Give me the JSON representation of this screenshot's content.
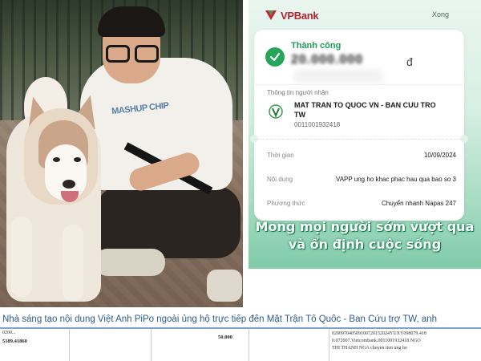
{
  "bank_app": {
    "brand": "VPBank",
    "close_label": "Xong",
    "status": "Thành công",
    "amount": "20.000.000",
    "currency": "đ",
    "recipient_section_label": "Thông tin người nhận",
    "recipient_name": "MAT TRAN TO QUOC VN - BAN CUU TRO TW",
    "recipient_account": "0011001932418",
    "time_label": "Thời gian",
    "time_value": "10/09/2024",
    "content_label": "Nội dung",
    "content_value": "VAPP ung ho khac phac hau qua bao so 3",
    "method_label": "Phương thức",
    "method_value": "Chuyển nhanh Napas 247",
    "accent_green": "#27a65a",
    "brand_red": "#b52431"
  },
  "overlay_caption": "Mong mọi người sớm vượt qua và ổn định cuộc sống",
  "headline": "Nhà sáng tạo nội dung Việt Anh PiPo ngoài ủng hộ trực tiếp đến Mặt Trận Tổ Quốc - Ban Cứu trợ TW, anh",
  "statement": {
    "ref_small": "0200...",
    "doc_no": "5189.41860",
    "amount": "50.000",
    "desc_line1": "020097040509100720152024YUXY098079.418",
    "desc_line2": "0.072007.Vietcombank.0011001932418.NGO",
    "desc_line3": "THI THANH NGA chuyen tien ung ho"
  },
  "photo": {
    "shirt_print": "MASHUP CHIP"
  }
}
